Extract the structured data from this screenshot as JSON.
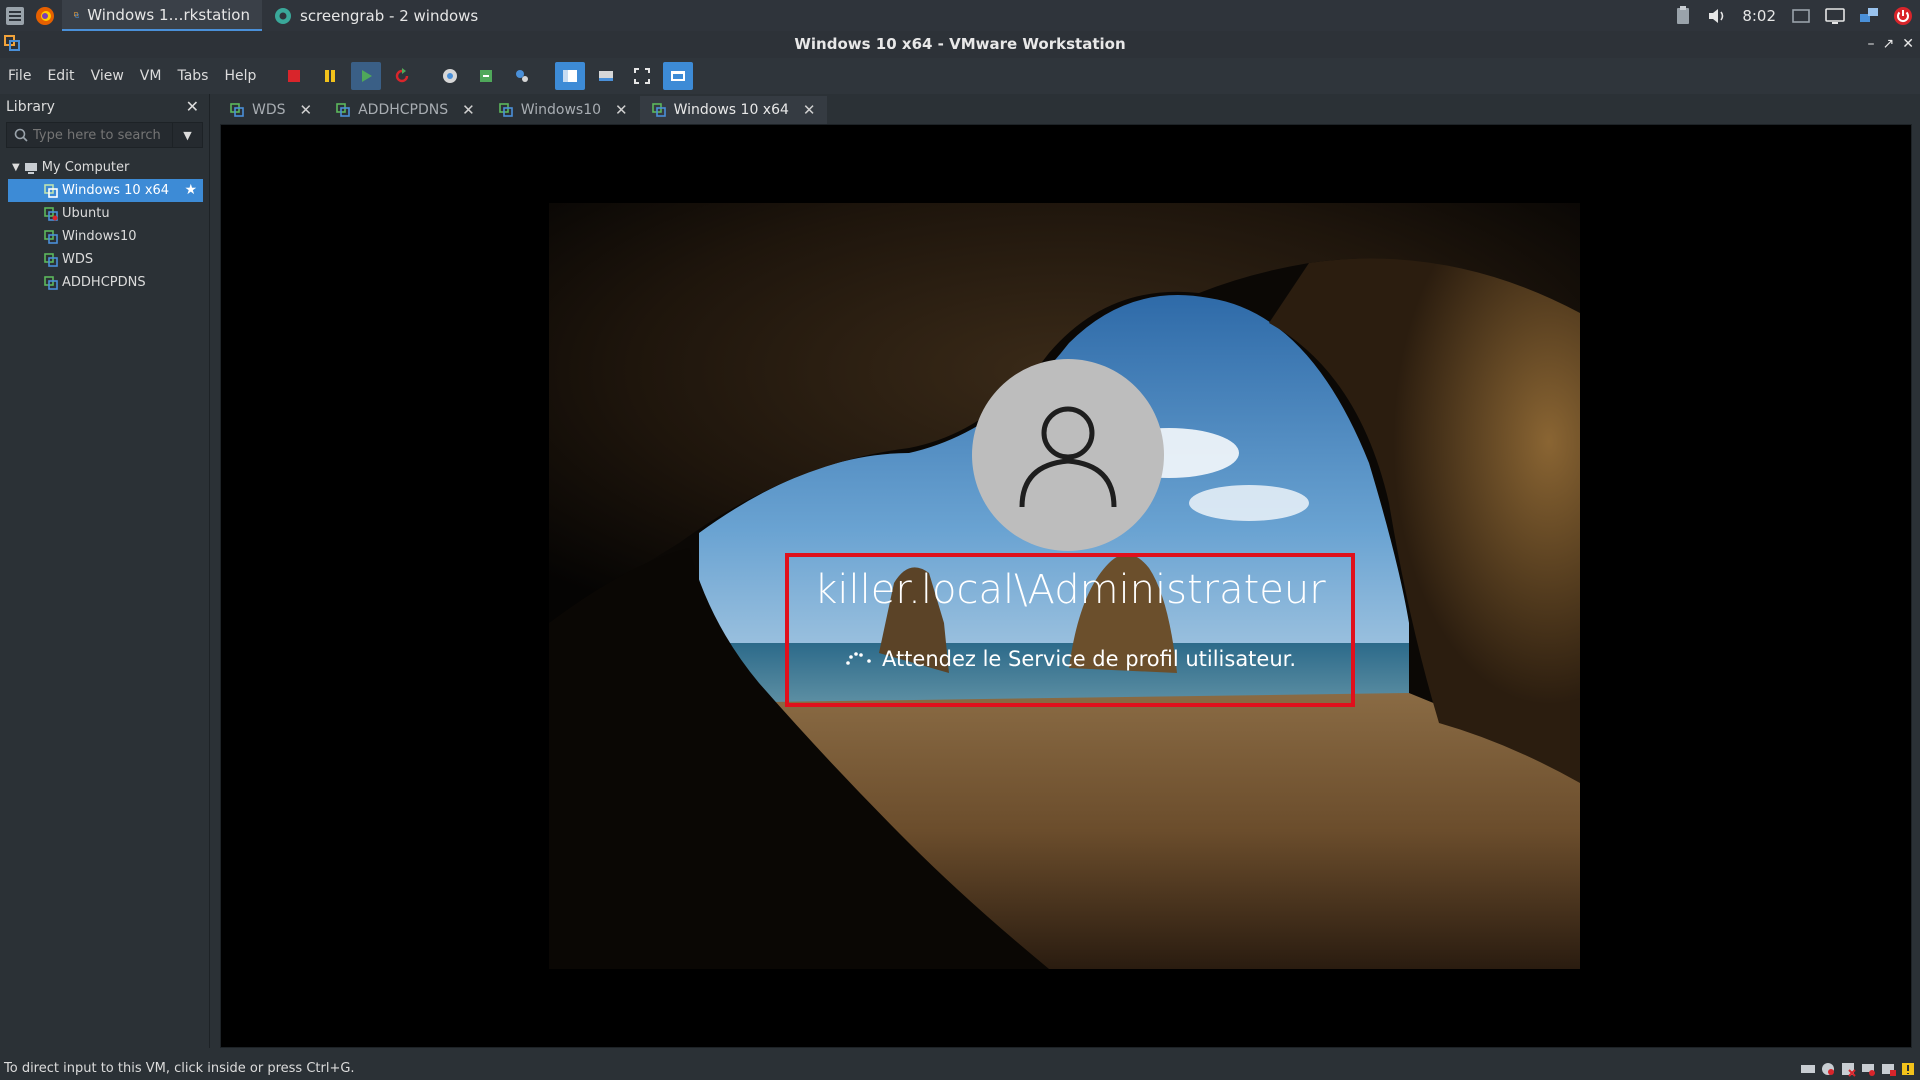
{
  "taskbar": {
    "tasks": [
      {
        "label": "Windows 1…rkstation",
        "icon": "vmware-icon",
        "active": true
      },
      {
        "label": "screengrab - 2 windows",
        "icon": "screengrab-icon",
        "active": false
      }
    ],
    "clock": "8:02"
  },
  "window": {
    "title": "Windows 10 x64 - VMware Workstation"
  },
  "menubar": {
    "items": [
      "File",
      "Edit",
      "View",
      "VM",
      "Tabs",
      "Help"
    ]
  },
  "library": {
    "title": "Library",
    "search_placeholder": "Type here to search",
    "root": "My Computer",
    "vms": [
      "Windows 10 x64",
      "Ubuntu",
      "Windows10",
      "WDS",
      "ADDHCPDNS"
    ],
    "selected": "Windows 10 x64"
  },
  "tabs": [
    {
      "label": "WDS",
      "active": false
    },
    {
      "label": "ADDHCPDNS",
      "active": false
    },
    {
      "label": "Windows10",
      "active": false
    },
    {
      "label": "Windows 10 x64",
      "active": true
    }
  ],
  "vm_screen": {
    "username": "killer.local\\Administrateur",
    "status": "Attendez le Service de profil utilisateur."
  },
  "statusbar": {
    "message": "To direct input to this VM, click inside or press Ctrl+G."
  },
  "colors": {
    "accent": "#3d8bd6",
    "highlight_box": "#e0101c"
  }
}
